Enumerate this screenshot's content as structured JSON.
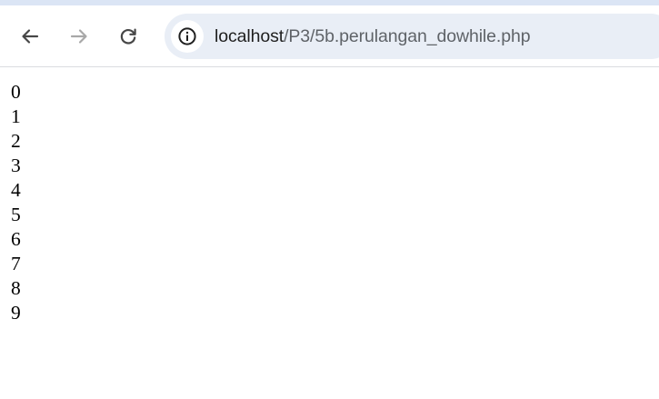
{
  "browser": {
    "url_host": "localhost",
    "url_path": "/P3/5b.perulangan_dowhile.php",
    "nav_icons": [
      "arrow-left-icon",
      "arrow-right-icon",
      "reload-icon",
      "info-icon"
    ]
  },
  "page": {
    "lines": [
      "0",
      "1",
      "2",
      "3",
      "4",
      "5",
      "6",
      "7",
      "8",
      "9"
    ]
  },
  "colors": {
    "omnibox_bg": "#e9eef6",
    "icon_active": "#474747",
    "icon_disabled": "#a8a8a8"
  }
}
